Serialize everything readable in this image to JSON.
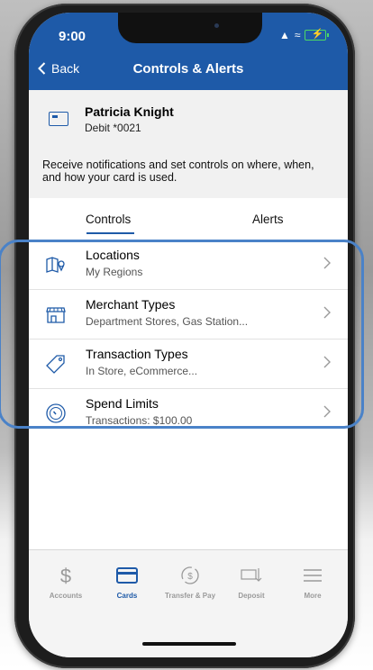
{
  "status_bar": {
    "time": "9:00"
  },
  "nav": {
    "back_label": "Back",
    "title": "Controls & Alerts"
  },
  "card": {
    "holder_name": "Patricia Knight",
    "card_number": "Debit *0021"
  },
  "notice": "Receive notifications and set controls on where, when, and how your card is used.",
  "tabs": [
    {
      "label": "Controls",
      "active": true
    },
    {
      "label": "Alerts",
      "active": false
    }
  ],
  "controls": [
    {
      "icon": "map-pin-icon",
      "title": "Locations",
      "subtitle": "My Regions"
    },
    {
      "icon": "storefront-icon",
      "title": "Merchant Types",
      "subtitle": "Department Stores, Gas Station..."
    },
    {
      "icon": "tag-icon",
      "title": "Transaction Types",
      "subtitle": "In Store, eCommerce..."
    },
    {
      "icon": "gauge-icon",
      "title": "Spend Limits",
      "subtitle": "Transactions: $100.00"
    }
  ],
  "tabbar": [
    {
      "icon": "dollar-icon",
      "label": "Accounts",
      "active": false
    },
    {
      "icon": "card-icon",
      "label": "Cards",
      "active": true
    },
    {
      "icon": "transfer-icon",
      "label": "Transfer & Pay",
      "active": false
    },
    {
      "icon": "deposit-icon",
      "label": "Deposit",
      "active": false
    },
    {
      "icon": "menu-icon",
      "label": "More",
      "active": false
    }
  ],
  "colors": {
    "primary": "#1e5aa8",
    "highlight": "#4a82c8",
    "inactive": "#9a9a9a"
  }
}
